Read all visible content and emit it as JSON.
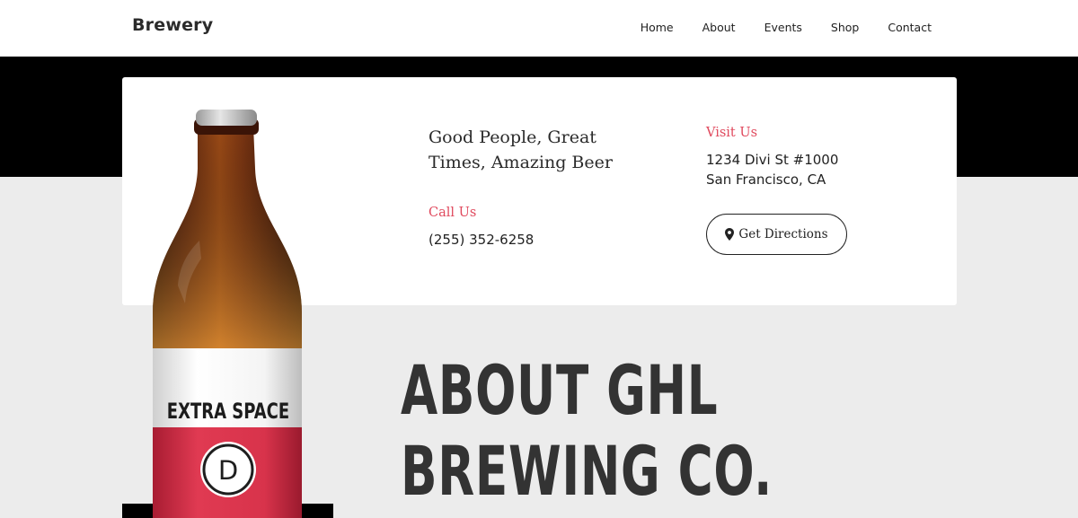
{
  "header": {
    "logo": "Brewery",
    "nav": [
      "Home",
      "About",
      "Events",
      "Shop",
      "Contact"
    ]
  },
  "contact": {
    "tagline_line1": "Good People, Great",
    "tagline_line2": "Times, Amazing Beer",
    "call_label": "Call Us",
    "phone": "(255) 352-6258",
    "visit_label": "Visit Us",
    "address_line1": "1234 Divi St #1000",
    "address_line2": "San Francisco, CA",
    "directions_button": "Get Directions"
  },
  "bottle": {
    "label_text": "EXTRA SPACE",
    "logo_letter": "D"
  },
  "about": {
    "line1": "ABOUT GHL",
    "line2": "BREWING CO."
  },
  "colors": {
    "accent": "#e0495d",
    "dark": "#2b2b2b",
    "band": "#000000",
    "page_bg": "#ececec"
  }
}
